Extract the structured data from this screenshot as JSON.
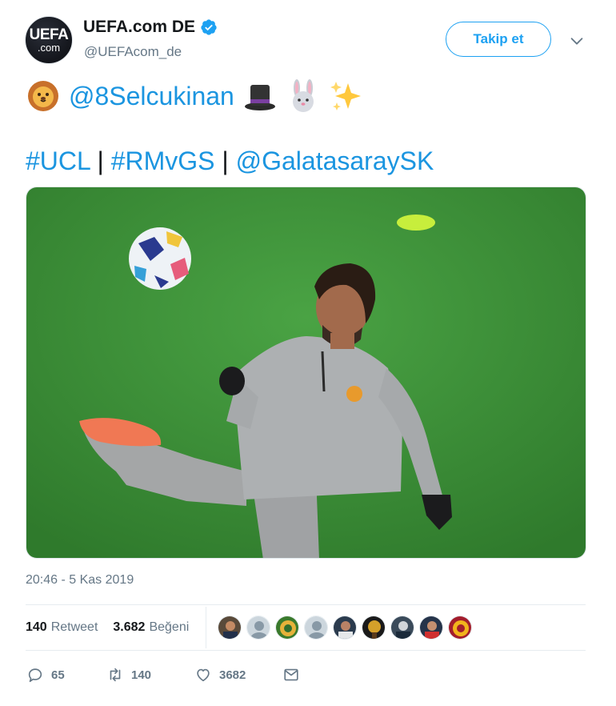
{
  "account": {
    "avatar_line1": "UEFA",
    "avatar_line2": ".com",
    "name": "UEFA.com DE",
    "handle": "@UEFAcom_de",
    "verified_icon": "verified-badge-icon"
  },
  "follow_label": "Takip et",
  "tweet": {
    "mention": "@8Selcukinan",
    "emojis": [
      "lion-emoji",
      "top-hat-emoji",
      "rabbit-emoji",
      "sparkles-emoji"
    ],
    "hashtag_ucl": "#UCL",
    "sep1": " | ",
    "hashtag_match": "#RMvGS",
    "sep2": " | ",
    "mention_club": "@GalatasaraySK"
  },
  "timestamp": "20:46 - 5 Kas 2019",
  "stats": {
    "retweets": "140",
    "retweets_label": "Retweet",
    "likes": "3.682",
    "likes_label": "Beğeni"
  },
  "actions": {
    "replies": "65",
    "retweets": "140",
    "likes": "3682"
  },
  "colors": {
    "link": "#1b95e0",
    "brand": "#1da1f2",
    "muted": "#657786",
    "pitch": "#3f8c3a"
  }
}
